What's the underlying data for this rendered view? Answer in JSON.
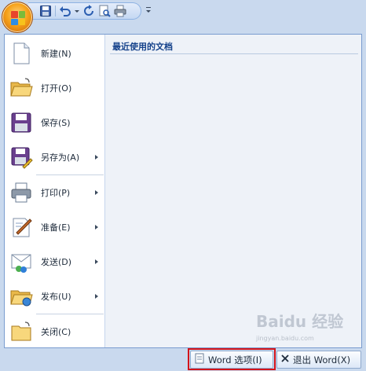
{
  "office_button": {
    "icon": "office-logo-icon"
  },
  "quick_access": {
    "items": [
      {
        "name": "save",
        "icon": "save-icon"
      },
      {
        "name": "undo",
        "icon": "undo-icon"
      },
      {
        "name": "redo",
        "icon": "redo-icon"
      },
      {
        "name": "print-preview",
        "icon": "print-preview-icon"
      },
      {
        "name": "quick-print",
        "icon": "printer-icon"
      }
    ]
  },
  "menu": {
    "items": [
      {
        "label": "新建(N)",
        "icon": "new-document-icon",
        "submenu": false
      },
      {
        "label": "打开(O)",
        "icon": "open-folder-icon",
        "submenu": false
      },
      {
        "label": "保存(S)",
        "icon": "save-disk-icon",
        "submenu": false
      },
      {
        "label": "另存为(A)",
        "icon": "save-as-icon",
        "submenu": true
      },
      {
        "label": "打印(P)",
        "icon": "printer-icon",
        "submenu": true
      },
      {
        "label": "准备(E)",
        "icon": "prepare-icon",
        "submenu": true
      },
      {
        "label": "发送(D)",
        "icon": "send-icon",
        "submenu": true
      },
      {
        "label": "发布(U)",
        "icon": "publish-icon",
        "submenu": true
      },
      {
        "label": "关闭(C)",
        "icon": "close-folder-icon",
        "submenu": false
      }
    ]
  },
  "recent": {
    "title": "最近使用的文档"
  },
  "buttons": {
    "options_label": "Word 选项(I)",
    "exit_label": "退出 Word(X)"
  },
  "watermark": {
    "text": "Baidu 经验",
    "sub": "jingyan.baidu.com"
  },
  "colors": {
    "highlight": "#d4141a",
    "accent": "#15428b"
  }
}
